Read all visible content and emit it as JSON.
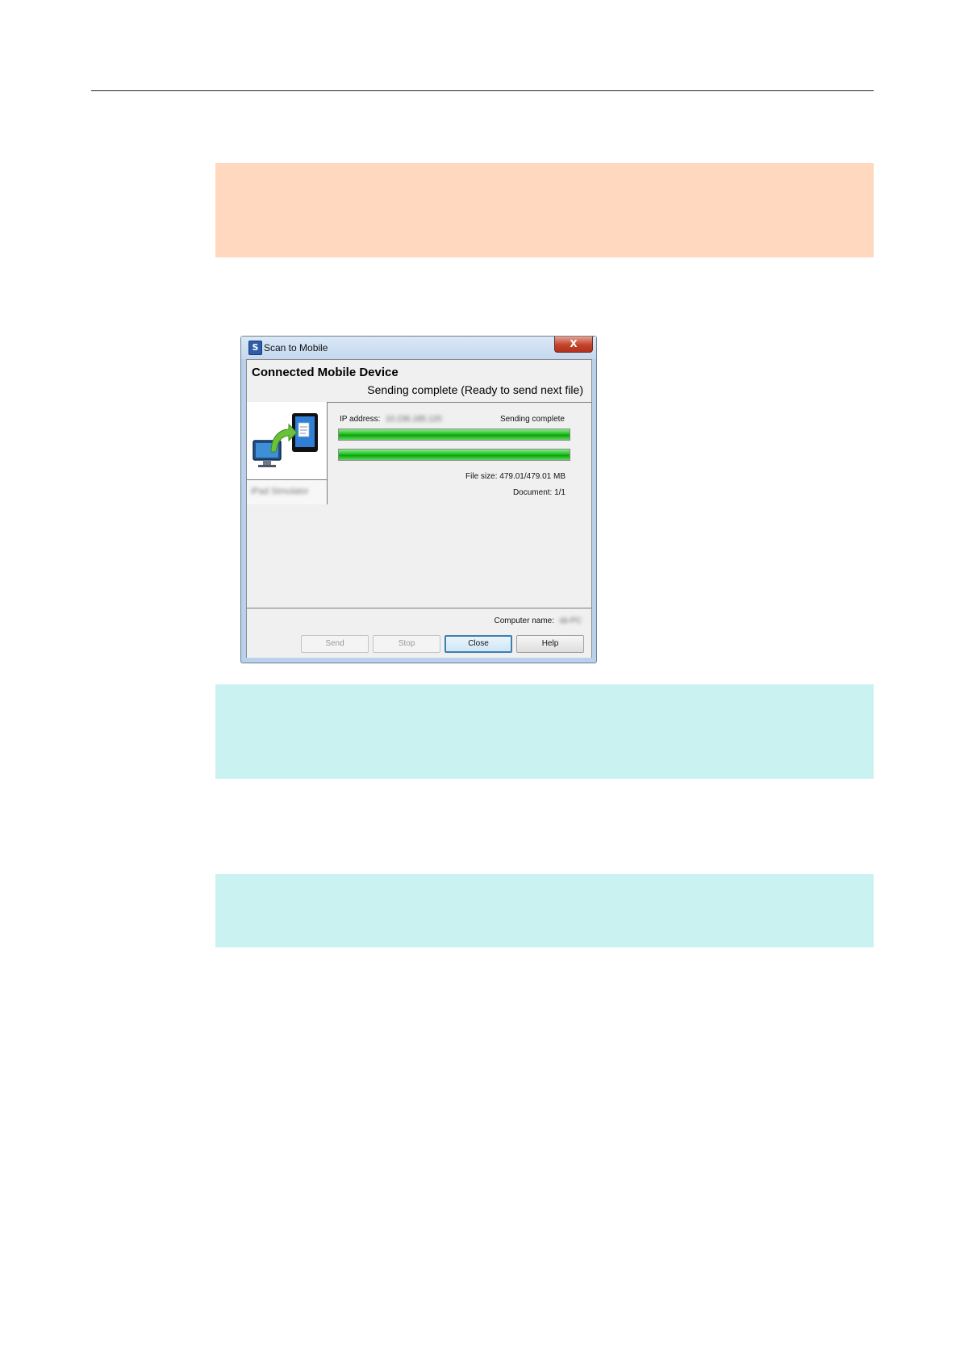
{
  "dialog": {
    "title": "Scan to Mobile",
    "app_icon_glyph": "S",
    "close_glyph": "X",
    "header_title": "Connected Mobile Device",
    "header_status": "Sending complete (Ready to send next file)",
    "device_name": "iPad Simulator",
    "ip_label": "IP address:",
    "ip_value": "10.236.185.120",
    "sending_status": "Sending complete",
    "progress": [
      {
        "name": "file-progress",
        "percent": 100
      },
      {
        "name": "document-progress",
        "percent": 100
      }
    ],
    "file_size": "File size: 479.01/479.01 MB",
    "document_count": "Document: 1/1",
    "computer_label": "Computer name:",
    "computer_value": "sb-PC",
    "buttons": {
      "send": "Send",
      "stop": "Stop",
      "close": "Close",
      "help": "Help"
    }
  },
  "colors": {
    "warning_note": "#ffd8bf",
    "info_note": "#c9f2f1",
    "progress_green": "#1fc21f",
    "focus_blue": "#3c7fb1"
  },
  "icons": {
    "device_icon": "computer-to-mobile-transfer-icon"
  }
}
